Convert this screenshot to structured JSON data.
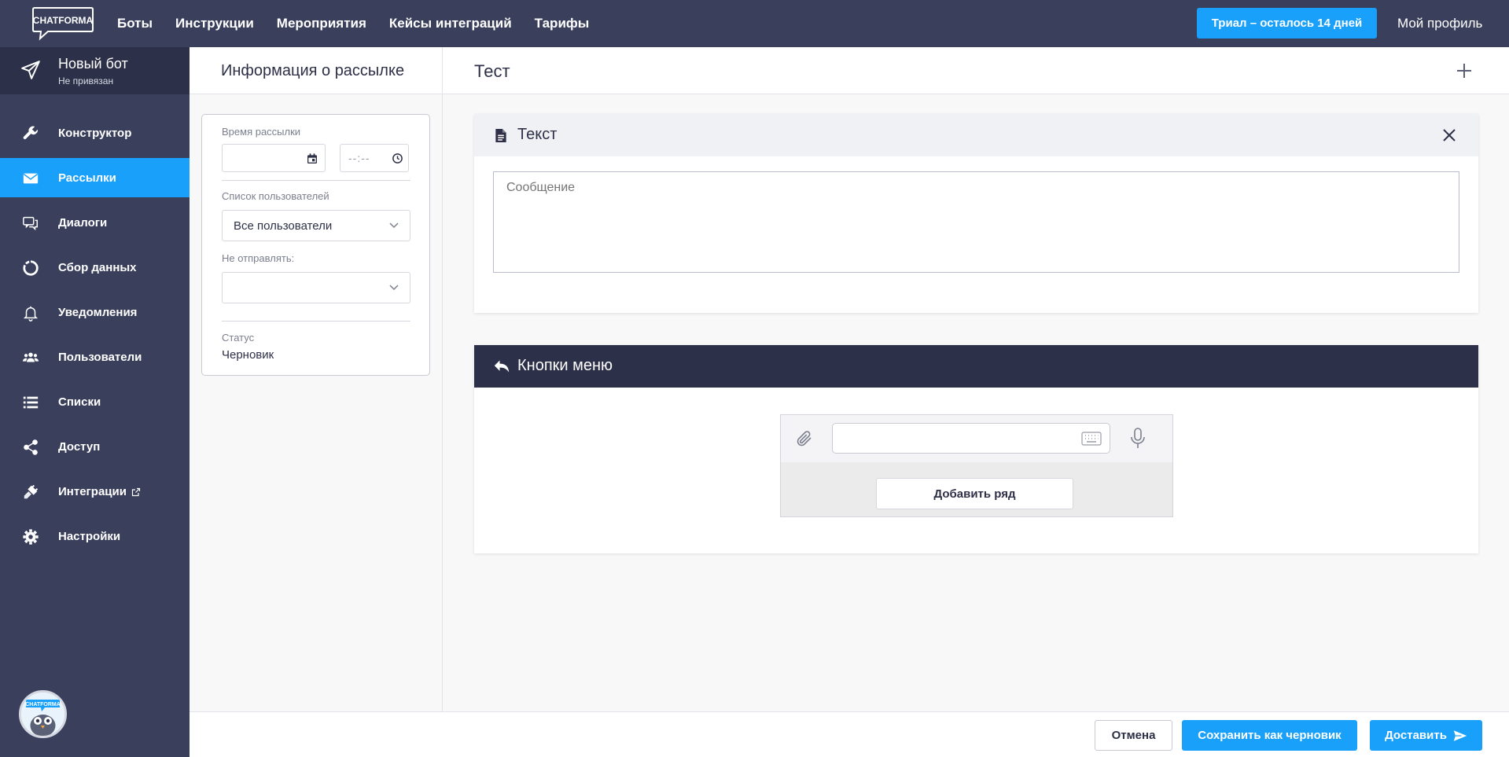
{
  "brand": {
    "logo_text": "CHATFORMA"
  },
  "nav": {
    "items": [
      "Боты",
      "Инструкции",
      "Мероприятия",
      "Кейсы интеграций",
      "Тарифы"
    ],
    "trial_button": "Триал – осталось 14 дней",
    "profile": "Мой профиль"
  },
  "bot": {
    "name": "Новый бот",
    "status": "Не привязан"
  },
  "sidebar": {
    "items": [
      {
        "label": "Конструктор",
        "icon": "wrench-icon"
      },
      {
        "label": "Рассылки",
        "icon": "envelope-icon",
        "active": true
      },
      {
        "label": "Диалоги",
        "icon": "chat-icon"
      },
      {
        "label": "Сбор данных",
        "icon": "chart-ring-icon"
      },
      {
        "label": "Уведомления",
        "icon": "bell-icon"
      },
      {
        "label": "Пользователи",
        "icon": "users-icon"
      },
      {
        "label": "Списки",
        "icon": "list-icon"
      },
      {
        "label": "Доступ",
        "icon": "share-icon"
      },
      {
        "label": "Интеграции",
        "icon": "plug-icon"
      },
      {
        "label": "Настройки",
        "icon": "gear-icon"
      }
    ],
    "avatar_text": "CHATFORMA"
  },
  "info": {
    "title": "Информация о рассылке",
    "time_label": "Время рассылки",
    "time_placeholder": "--:--",
    "users_label": "Список пользователей",
    "users_value": "Все пользователи",
    "exclude_label": "Не отправлять:",
    "exclude_value": "",
    "status_label": "Статус",
    "status_value": "Черновик"
  },
  "main": {
    "title": "Тест",
    "text_block": {
      "title": "Текст",
      "message_placeholder": "Сообщение"
    },
    "keyboard_block": {
      "title": "Кнопки меню",
      "add_row": "Добавить ряд"
    }
  },
  "actions": {
    "cancel": "Отмена",
    "save_draft": "Сохранить как черновик",
    "send": "Доставить"
  },
  "colors": {
    "nav_bg": "#3a3f5c",
    "sidebar_dark": "#2c3048",
    "accent": "#18a0fb"
  }
}
